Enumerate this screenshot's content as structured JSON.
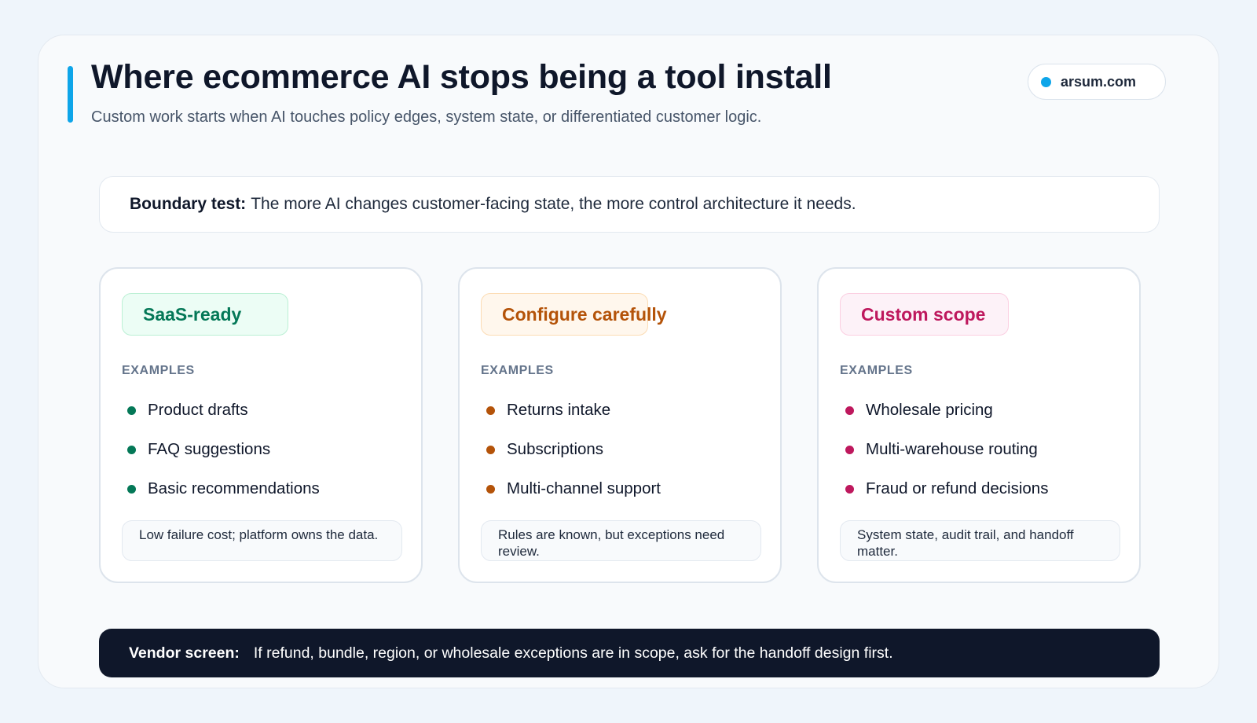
{
  "header": {
    "title": "Where ecommerce AI stops being a tool install",
    "subtitle": "Custom work starts when AI touches policy edges, system state, or differentiated customer logic.",
    "source": "arsum.com"
  },
  "boundary": {
    "lead": "Boundary test:",
    "text": "The more AI changes customer-facing state, the more control architecture it needs."
  },
  "columns": [
    {
      "badge": "SaaS-ready",
      "examples_label": "EXAMPLES",
      "items": [
        "Product drafts",
        "FAQ suggestions",
        "Basic recommendations"
      ],
      "note": "Low failure cost; platform owns the data.",
      "color": "#047857"
    },
    {
      "badge": "Configure carefully",
      "examples_label": "EXAMPLES",
      "items": [
        "Returns intake",
        "Subscriptions",
        "Multi-channel support"
      ],
      "note": "Rules are known, but exceptions need review.",
      "color": "#b45309"
    },
    {
      "badge": "Custom scope",
      "examples_label": "EXAMPLES",
      "items": [
        "Wholesale pricing",
        "Multi-warehouse routing",
        "Fraud or refund decisions"
      ],
      "note": "System state, audit trail, and handoff matter.",
      "color": "#be185d"
    }
  ],
  "vendor": {
    "lead": "Vendor screen:",
    "text": "If refund, bundle, region, or wholesale exceptions are in scope, ask for the handoff design first."
  },
  "colors": {
    "accent": "#0ea5e9",
    "dark_banner": "#0f172a"
  }
}
